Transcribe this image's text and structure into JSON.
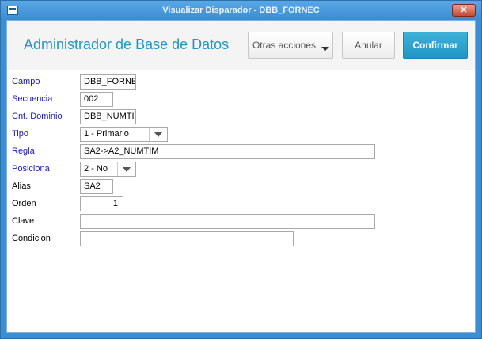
{
  "window": {
    "title": "Visualizar Disparador - DBB_FORNEC",
    "close_glyph": "✕"
  },
  "header": {
    "title": "Administrador de Base de Datos",
    "buttons": {
      "otras": "Otras acciones",
      "anular": "Anular",
      "confirmar": "Confirmar"
    }
  },
  "form": {
    "campo": {
      "label": "Campo",
      "value": "DBB_FORNEC"
    },
    "secuencia": {
      "label": "Secuencia",
      "value": "002"
    },
    "cnt_dominio": {
      "label": "Cnt. Dominio",
      "value": "DBB_NUMTIM"
    },
    "tipo": {
      "label": "Tipo",
      "value": "1 - Primario"
    },
    "regla": {
      "label": "Regla",
      "value": "SA2->A2_NUMTIM"
    },
    "posiciona": {
      "label": "Posiciona",
      "value": "2 - No"
    },
    "alias": {
      "label": "Alias",
      "value": "SA2"
    },
    "orden": {
      "label": "Orden",
      "value": "1"
    },
    "clave": {
      "label": "Clave",
      "value": ""
    },
    "condicion": {
      "label": "Condicion",
      "value": ""
    }
  },
  "colors": {
    "label_required": "#1a1aa6",
    "accent": "#2596c0",
    "confirm_button": "#1f96c4"
  }
}
